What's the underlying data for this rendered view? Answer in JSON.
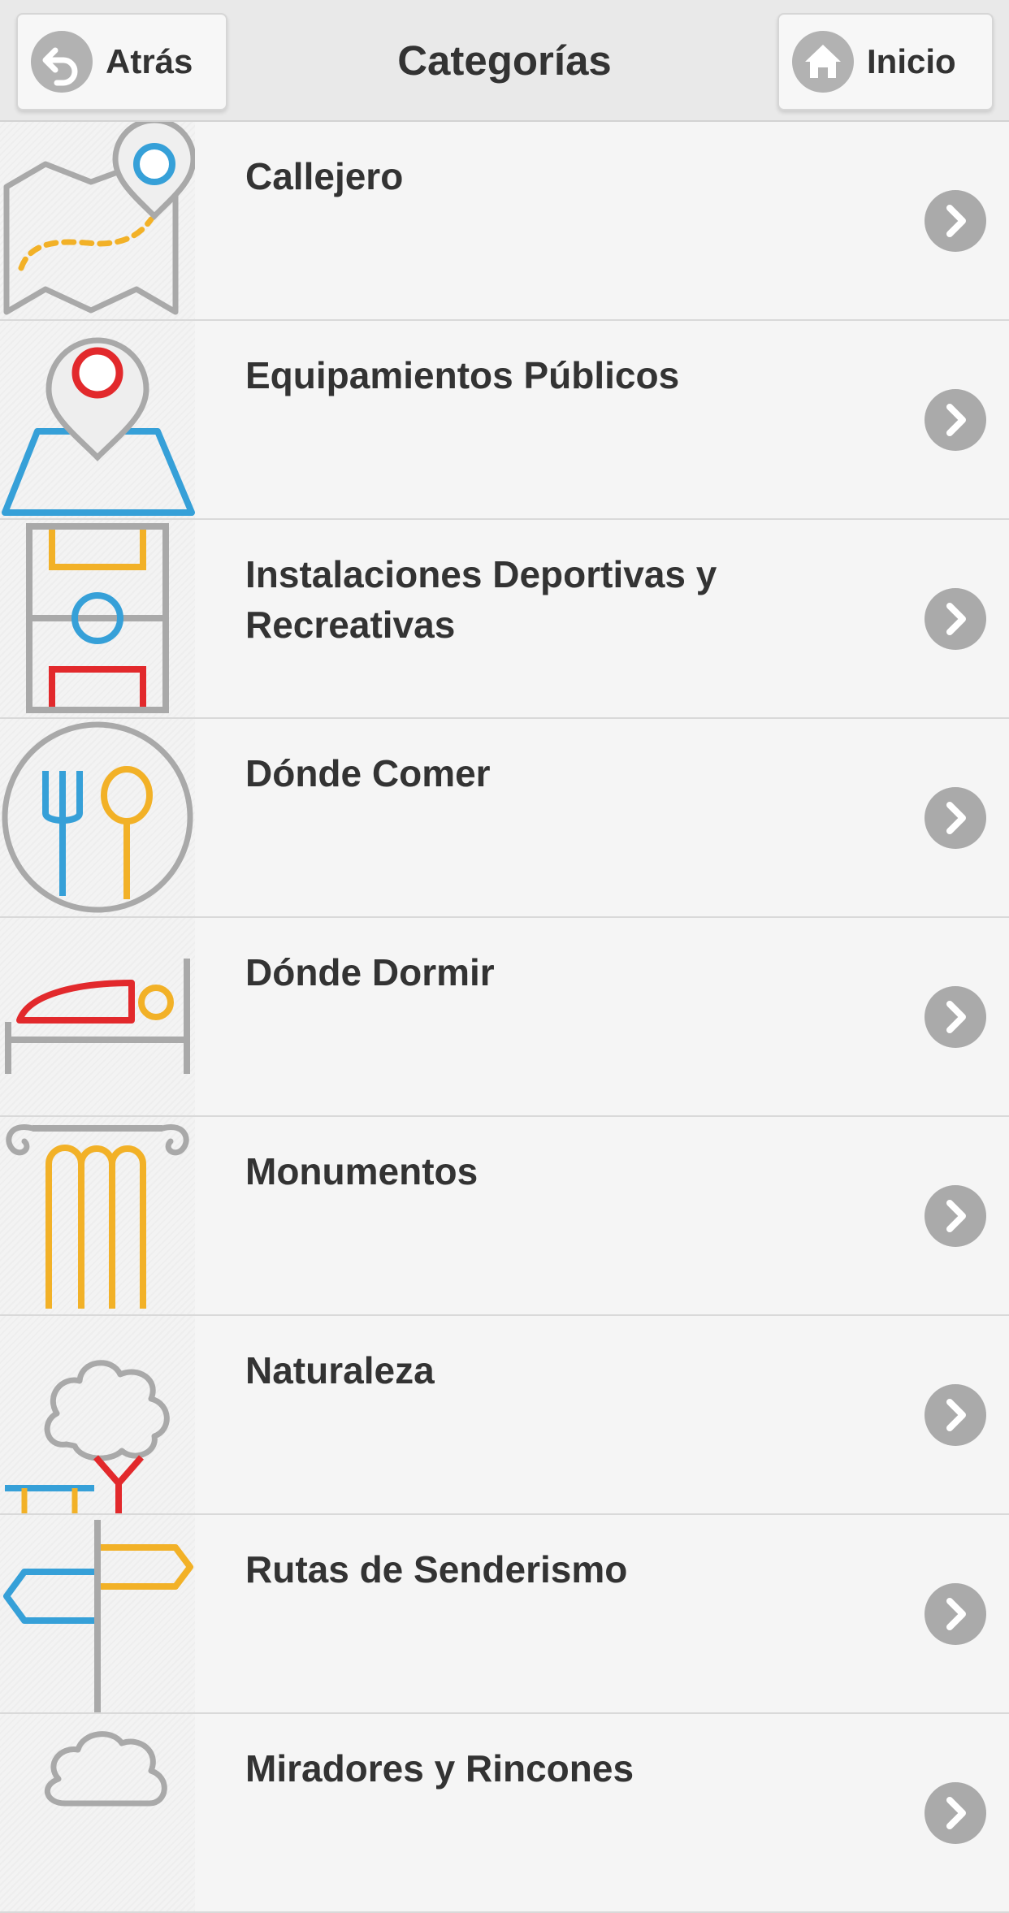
{
  "header": {
    "title": "Categorías",
    "back_label": "Atrás",
    "home_label": "Inicio"
  },
  "categories": [
    {
      "label": "Callejero",
      "icon": "street-map-icon"
    },
    {
      "label": "Equipamientos Públicos",
      "icon": "public-facilities-icon"
    },
    {
      "label": "Instalaciones Deportivas y Recreativas",
      "icon": "sports-field-icon"
    },
    {
      "label": "Dónde Comer",
      "icon": "fork-spoon-icon"
    },
    {
      "label": "Dónde Dormir",
      "icon": "bed-icon"
    },
    {
      "label": "Monumentos",
      "icon": "column-icon"
    },
    {
      "label": "Naturaleza",
      "icon": "tree-icon"
    },
    {
      "label": "Rutas de Senderismo",
      "icon": "signpost-icon"
    },
    {
      "label": "Miradores y Rincones",
      "icon": "viewpoint-icon"
    }
  ],
  "colors": {
    "gray": "#a9a9a9",
    "blue": "#36a0d8",
    "yellow": "#f2b127",
    "red": "#e2292c"
  }
}
